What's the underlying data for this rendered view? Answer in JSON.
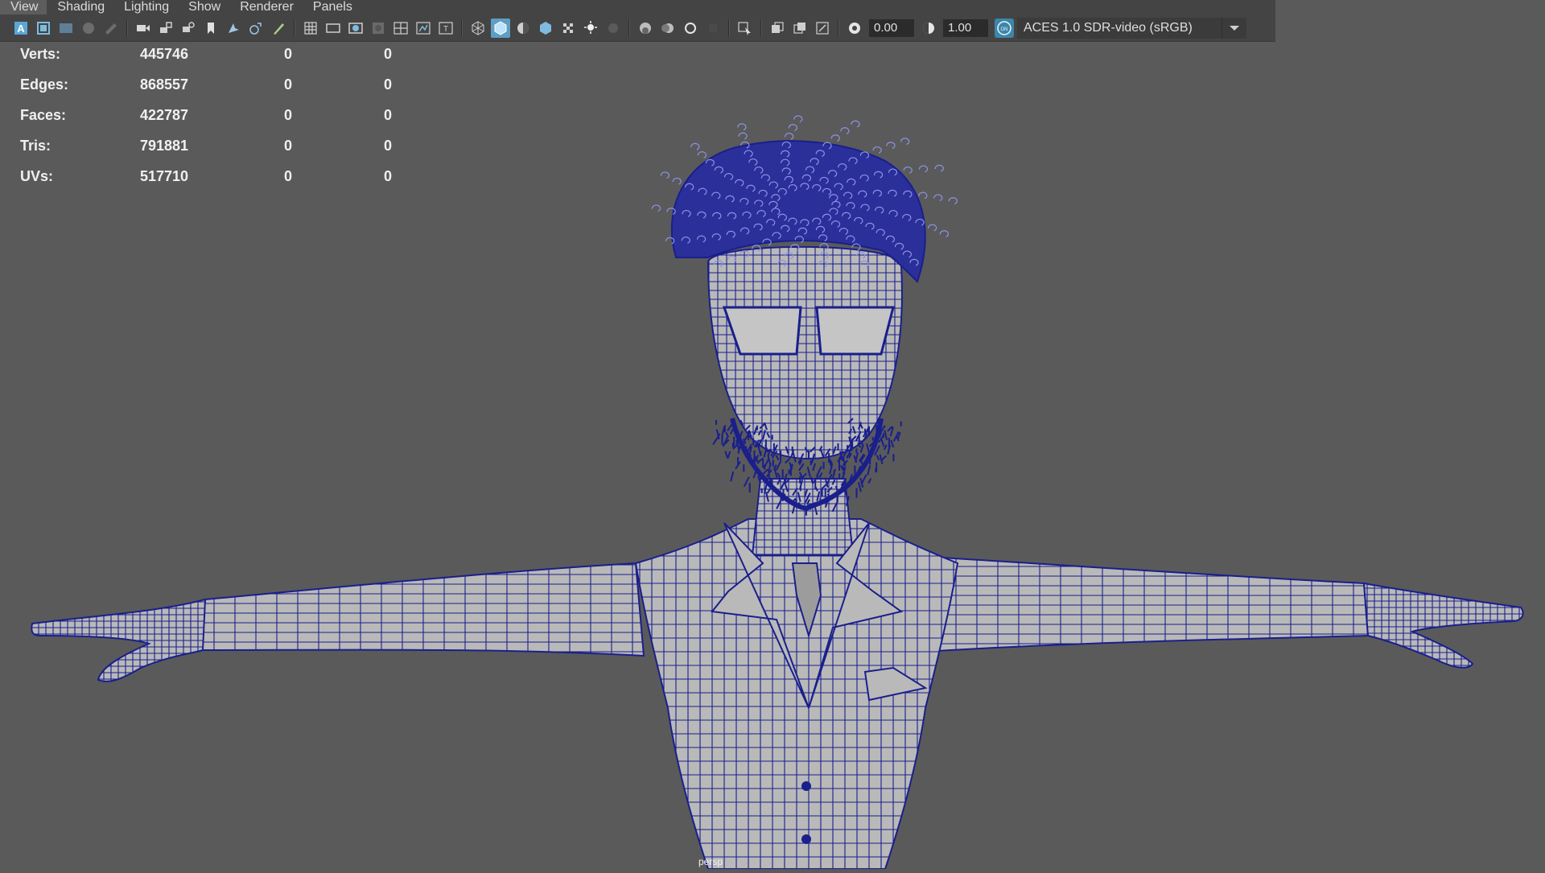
{
  "menu": [
    "View",
    "Shading",
    "Lighting",
    "Show",
    "Renderer",
    "Panels"
  ],
  "toolbar": {
    "exposure_value": "0.00",
    "gamma_value": "1.00",
    "color_mgmt_badge": "ON",
    "color_transform": "ACES 1.0 SDR-video (sRGB)",
    "active_accent": "#5e9ec4"
  },
  "hud": {
    "rows": [
      {
        "label": "Verts:",
        "total": "445746",
        "selected": "0",
        "component": "0"
      },
      {
        "label": "Edges:",
        "total": "868557",
        "selected": "0",
        "component": "0"
      },
      {
        "label": "Faces:",
        "total": "422787",
        "selected": "0",
        "component": "0"
      },
      {
        "label": "Tris:",
        "total": "791881",
        "selected": "0",
        "component": "0"
      },
      {
        "label": "UVs:",
        "total": "517710",
        "selected": "0",
        "component": "0"
      }
    ]
  },
  "viewport": {
    "camera": "persp",
    "wire_color": "#1a1f8c",
    "mesh_color": "#b9b9b9",
    "background": "#5a5a5a"
  }
}
